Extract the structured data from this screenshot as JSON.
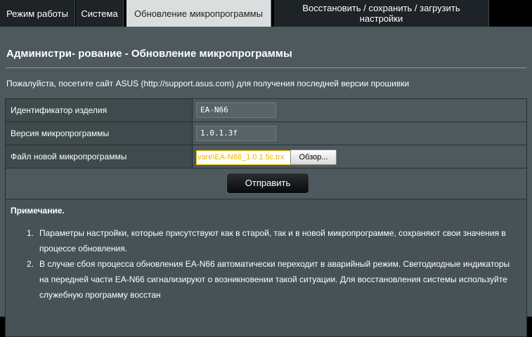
{
  "tabs": [
    {
      "label": "Режим работы"
    },
    {
      "label": "Система"
    },
    {
      "label": "Обновление микропрограммы"
    },
    {
      "label_line1": "Восстановить / сохранить / загрузить",
      "label_line2": "настройки"
    }
  ],
  "page": {
    "title": "Администри- рование - Обновление микропрограммы",
    "intro": "Пожалуйста, посетите сайт ASUS (http://support.asus.com) для получения последней версии прошивки"
  },
  "form": {
    "product_id_label": "Идентификатор изделия",
    "product_id_value": "EA-N66",
    "fw_version_label": "Версия микропрограммы",
    "fw_version_value": "1.0.1.3f",
    "new_fw_label": "Файл новой микропрограммы",
    "new_fw_file_value": "vare\\EA-N66_1.0.1.5c.trx",
    "browse_label": "Обзор...",
    "submit_label": "Отправить"
  },
  "note": {
    "title": "Примечание.",
    "items": [
      {
        "num": "1.",
        "text": "Параметры настройки, которые присутствуют как в старой, так и в новой микропрограмме, сохраняют свои значения в процессе обновления."
      },
      {
        "num": "2.",
        "text": "В случае сбоя процесса обновления EA-N66 автоматически переходит в аварийный режим. Светодиодные индикаторы на передней части EA-N66 сигнализируют о возникновении такой ситуации. Для восстановления системы используйте служебную программу восстан"
      }
    ]
  },
  "colors": {
    "panel_bg": "#4d595d",
    "tab_active_bg": "#dadedf",
    "tab_bg": "#1d2326",
    "file_input_border": "#e6c400"
  }
}
